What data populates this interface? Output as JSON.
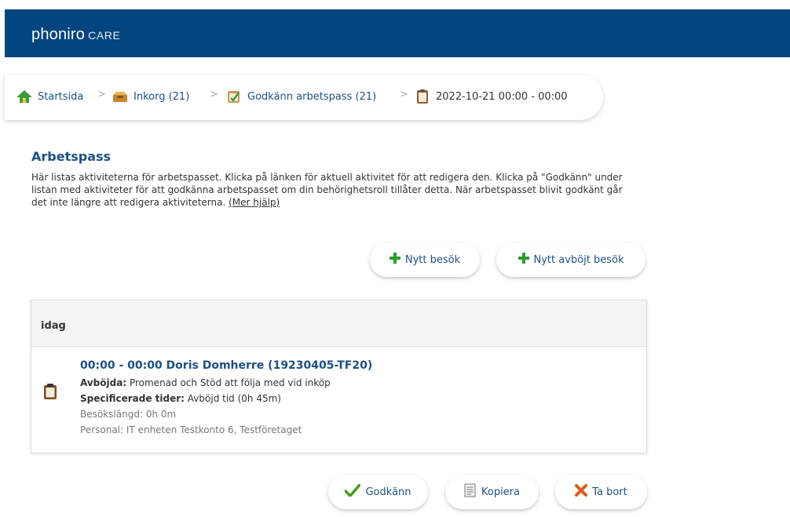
{
  "app": {
    "brand": "phoniro",
    "brand_suffix": "CARE"
  },
  "breadcrumb": {
    "items": [
      {
        "label": "Startsida",
        "icon": "home-icon"
      },
      {
        "label": "Inkorg (21)",
        "icon": "inbox-icon"
      },
      {
        "label": "Godkänn arbetspass (21)",
        "icon": "approve-shift-icon"
      },
      {
        "label": "2022-10-21 00:00 - 00:00",
        "icon": "clipboard-icon"
      }
    ],
    "separator": ">"
  },
  "page": {
    "title": "Arbetspass",
    "intro": "Här listas aktiviteterna för arbetspasset. Klicka på länken för aktuell aktivitet för att redigera den. Klicka på \"Godkänn\" under listan med aktiviteter för att godkänna arbetspasset om din behörighetsroll tillåter detta. När arbetspasset blivit godkänt går det inte längre att redigera aktiviteterna.",
    "help_link": "(Mer hjälp)"
  },
  "actions": {
    "new_visit": "Nytt besök",
    "new_declined_visit": "Nytt avböjt besök"
  },
  "list": {
    "group_header": "idag",
    "items": [
      {
        "title": "00:00 - 00:00 Doris Domherre (19230405-TF20)",
        "declined_label": "Avböjda:",
        "declined_value": "Promenad och Stöd att följa med vid inköp",
        "specified_label": "Specificerade tider:",
        "specified_value": "Avböjd tid (0h 45m)",
        "duration_label": "Besökslängd:",
        "duration_value": "0h 0m",
        "staff_label": "Personal:",
        "staff_value": "IT enheten Testkonto 6, Testföretaget"
      }
    ]
  },
  "footer_actions": {
    "approve": "Godkänn",
    "copy": "Kopiera",
    "delete": "Ta bort"
  },
  "colors": {
    "header_bg": "#03457e",
    "link": "#1f4f86",
    "plus": "#2e9b2e",
    "check": "#4a9a24",
    "delete": "#e05a1b"
  }
}
